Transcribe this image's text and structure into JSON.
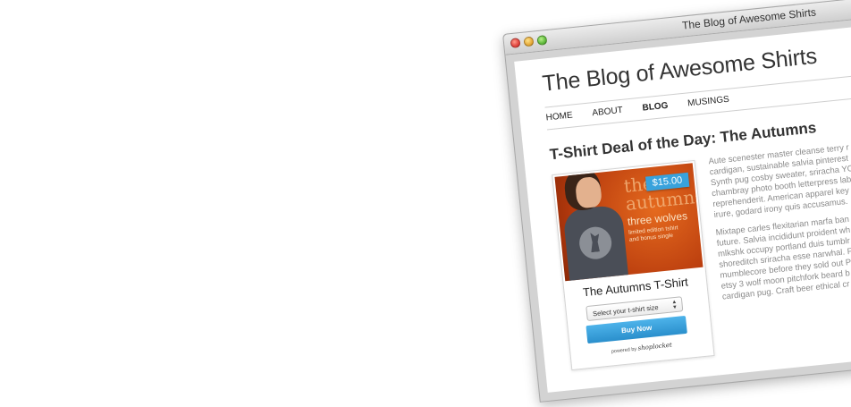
{
  "window": {
    "title": "The Blog of Awesome Shirts"
  },
  "site": {
    "title": "The Blog of Awesome Shirts"
  },
  "nav": {
    "items": [
      {
        "label": "HOME",
        "active": false
      },
      {
        "label": "ABOUT",
        "active": false
      },
      {
        "label": "BLOG",
        "active": true
      },
      {
        "label": "MUSINGS",
        "active": false
      }
    ]
  },
  "post": {
    "title": "T-Shirt Deal of the Day: The Autumns",
    "paragraph1": [
      "Aute scenester master cleanse terry r",
      "cardigan, sustainable salvia pinterest",
      "Synth pug cosby sweater, sriracha YO",
      "chambray photo booth letterpress lab",
      "reprehenderit. American apparel key",
      "irure, godard irony quis accusamus."
    ],
    "paragraph2": [
      "Mixtape carles flexitarian marfa ban",
      "future. Salvia incididunt proident wh",
      "mlkshk occupy portland duis tumblr",
      "shoreditch sriracha esse narwhal. F",
      "mumblecore before they sold out P",
      "etsy 3 wolf moon pitchfork beard b",
      "cardigan pug. Craft beer ethical cr"
    ]
  },
  "product": {
    "price": "$15.00",
    "name": "The Autumns T-Shirt",
    "image_text": {
      "line1": "the",
      "line2": "autumns",
      "line3": "three wolves",
      "line4": "limited edition tshirt",
      "line5": "and bonus single"
    },
    "size_select_value": "Select your t-shirt size",
    "buy_label": "Buy Now",
    "powered_by": "powered by",
    "powered_brand": "shoplocket"
  },
  "colors": {
    "accent_blue": "#39a2dc",
    "image_orange": "#b73a0d"
  }
}
